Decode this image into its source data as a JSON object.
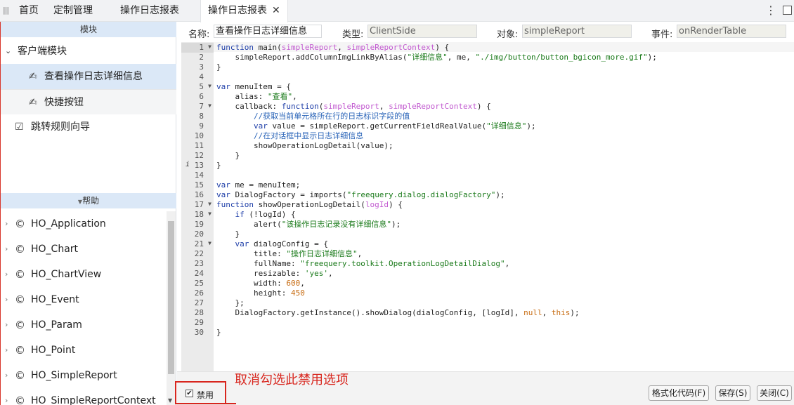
{
  "tabs": {
    "home": "首页",
    "custom": "定制管理",
    "log1": "操作日志报表",
    "log2": "操作日志报表",
    "close": "✕"
  },
  "left": {
    "module_header": "模块",
    "tree": {
      "client_module": "客户端模块",
      "view_log_detail": "查看操作日志详细信息",
      "shortcut": "快捷按钮",
      "redirect_wizard": "跳转规则向导"
    },
    "help_header": "帮助",
    "help_items": [
      "HO_Application",
      "HO_Chart",
      "HO_ChartView",
      "HO_Event",
      "HO_Param",
      "HO_Point",
      "HO_SimpleReport",
      "HO_SimpleReportContext"
    ]
  },
  "form": {
    "name_label": "名称:",
    "name_value": "查看操作日志详细信息",
    "type_label": "类型:",
    "type_value": "ClientSide",
    "object_label": "对象:",
    "object_value": "simpleReport",
    "event_label": "事件:",
    "event_value": "onRenderTable"
  },
  "code_lines": [
    "function main(simpleReport, simpleReportContext) {",
    "    simpleReport.addColumnImgLinkByAlias(\"详细信息\", me, \"./img/button/button_bgicon_more.gif\");",
    "}",
    "",
    "var menuItem = {",
    "    alias: \"查看\",",
    "    callback: function(simpleReport, simpleReportContext) {",
    "        //获取当前单元格所在行的日志标识字段的值",
    "        var value = simpleReport.getCurrentFieldRealValue(\"详细信息\");",
    "        //在对话框中显示日志详细信息",
    "        showOperationLogDetail(value);",
    "    }",
    "}",
    "",
    "var me = menuItem;",
    "var DialogFactory = imports(\"freequery.dialog.dialogFactory\");",
    "function showOperationLogDetail(logId) {",
    "    if (!logId) {",
    "        alert(\"该操作日志记录没有详细信息\");",
    "    }",
    "    var dialogConfig = {",
    "        title: \"操作日志详细信息\",",
    "        fullName: \"freequery.toolkit.OperationLogDetailDialog\",",
    "        resizable: 'yes',",
    "        width: 600,",
    "        height: 450",
    "    };",
    "    DialogFactory.getInstance().showDialog(dialogConfig, [logId], null, this);",
    "",
    "}"
  ],
  "bottom": {
    "disable_label": "禁用",
    "annotation": "取消勾选此禁用选项",
    "format_button": "格式化代码(F)",
    "save_button": "保存(S)",
    "close_button": "关闭(C)"
  },
  "colors": {
    "accent_highlight": "#dbe8f7",
    "annotation_red": "#d8261e",
    "keyword_blue": "#1e3ea8",
    "string_green": "#1a7a1a"
  }
}
